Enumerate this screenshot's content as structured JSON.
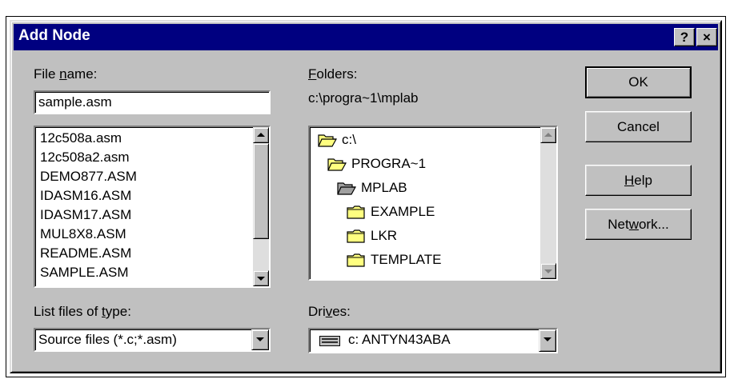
{
  "window": {
    "title": "Add Node",
    "help_btn": "?",
    "close_btn": "×"
  },
  "file_name": {
    "label_pre": "File ",
    "label_ul": "n",
    "label_post": "ame:",
    "value": "sample.asm"
  },
  "file_list": {
    "items": [
      "12c508a.asm",
      "12c508a2.asm",
      "DEMO877.ASM",
      "IDASM16.ASM",
      "IDASM17.ASM",
      "MUL8X8.ASM",
      "README.ASM",
      "SAMPLE.ASM"
    ]
  },
  "file_type": {
    "label_pre": "List files of ",
    "label_ul": "t",
    "label_post": "ype:",
    "value": "Source files (*.c;*.asm)"
  },
  "folders": {
    "label_pre": "",
    "label_ul": "F",
    "label_post": "olders:",
    "path": "c:\\progra~1\\mplab",
    "items": [
      {
        "name": "c:\\",
        "icon": "open-folder-icon"
      },
      {
        "name": "PROGRA~1",
        "icon": "open-folder-icon"
      },
      {
        "name": "MPLAB",
        "icon": "open-folder-icon"
      },
      {
        "name": "EXAMPLE",
        "icon": "folder-icon"
      },
      {
        "name": "LKR",
        "icon": "folder-icon"
      },
      {
        "name": "TEMPLATE",
        "icon": "folder-icon"
      }
    ]
  },
  "drives": {
    "label_pre": "Dri",
    "label_ul": "v",
    "label_post": "es:",
    "value": "c: ANTYN43ABA",
    "icon": "drive-icon"
  },
  "buttons": {
    "ok": "OK",
    "cancel": "Cancel",
    "help_ul": "H",
    "help_post": "elp",
    "network_pre": "Net",
    "network_ul": "w",
    "network_post": "ork..."
  }
}
